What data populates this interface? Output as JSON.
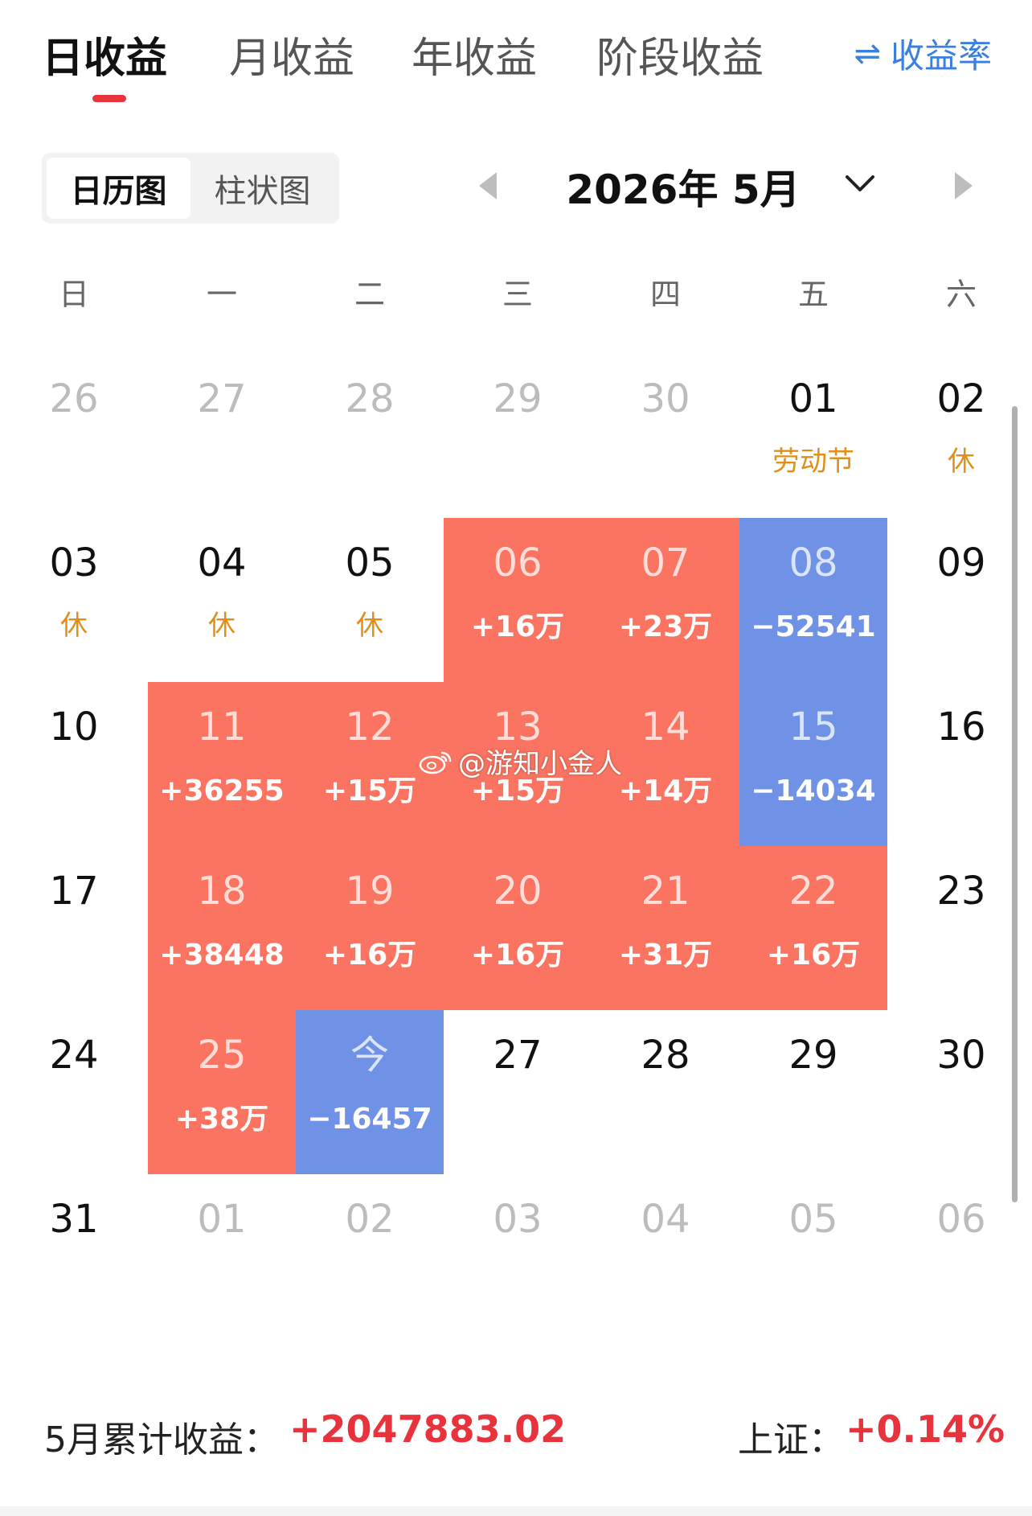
{
  "tabs": [
    {
      "label": "日收益",
      "active": true
    },
    {
      "label": "月收益",
      "active": false
    },
    {
      "label": "年收益",
      "active": false
    },
    {
      "label": "阶段收益",
      "active": false
    }
  ],
  "rate_toggle": {
    "icon": "swap-arrows-icon",
    "label": "收益率"
  },
  "view_switch": [
    {
      "label": "日历图",
      "active": true
    },
    {
      "label": "柱状图",
      "active": false
    }
  ],
  "month_nav": {
    "title": "2026年 5月"
  },
  "weekdays": [
    "日",
    "一",
    "二",
    "三",
    "四",
    "五",
    "六"
  ],
  "calendar": {
    "weeks": [
      [
        {
          "day": "26",
          "other": true
        },
        {
          "day": "27",
          "other": true
        },
        {
          "day": "28",
          "other": true
        },
        {
          "day": "29",
          "other": true
        },
        {
          "day": "30",
          "other": true
        },
        {
          "day": "01",
          "holiday": "劳动节"
        },
        {
          "day": "02",
          "holiday": "休"
        }
      ],
      [
        {
          "day": "03",
          "holiday": "休"
        },
        {
          "day": "04",
          "holiday": "休"
        },
        {
          "day": "05",
          "holiday": "休"
        },
        {
          "day": "06",
          "value": "+16万",
          "tone": "red"
        },
        {
          "day": "07",
          "value": "+23万",
          "tone": "red"
        },
        {
          "day": "08",
          "value": "−52541",
          "tone": "blue"
        },
        {
          "day": "09"
        }
      ],
      [
        {
          "day": "10"
        },
        {
          "day": "11",
          "value": "+36255",
          "tone": "red"
        },
        {
          "day": "12",
          "value": "+15万",
          "tone": "red"
        },
        {
          "day": "13",
          "value": "+15万",
          "tone": "red"
        },
        {
          "day": "14",
          "value": "+14万",
          "tone": "red"
        },
        {
          "day": "15",
          "value": "−14034",
          "tone": "blue"
        },
        {
          "day": "16"
        }
      ],
      [
        {
          "day": "17"
        },
        {
          "day": "18",
          "value": "+38448",
          "tone": "red"
        },
        {
          "day": "19",
          "value": "+16万",
          "tone": "red"
        },
        {
          "day": "20",
          "value": "+16万",
          "tone": "red"
        },
        {
          "day": "21",
          "value": "+31万",
          "tone": "red"
        },
        {
          "day": "22",
          "value": "+16万",
          "tone": "red"
        },
        {
          "day": "23"
        }
      ],
      [
        {
          "day": "24"
        },
        {
          "day": "25",
          "value": "+38万",
          "tone": "red"
        },
        {
          "day": "今",
          "value": "−16457",
          "tone": "blue"
        },
        {
          "day": "27"
        },
        {
          "day": "28"
        },
        {
          "day": "29"
        },
        {
          "day": "30"
        }
      ],
      [
        {
          "day": "31"
        },
        {
          "day": "01",
          "other": true
        },
        {
          "day": "02",
          "other": true
        },
        {
          "day": "03",
          "other": true
        },
        {
          "day": "04",
          "other": true
        },
        {
          "day": "05",
          "other": true
        },
        {
          "day": "06",
          "other": true
        }
      ]
    ]
  },
  "colors": {
    "profit": "#fa7461",
    "loss": "#7092e6",
    "holiday": "#e0901a",
    "accent": "#e8323c",
    "link": "#3b7fe0"
  },
  "watermark": {
    "icon": "weibo-icon",
    "text": "@游知小金人"
  },
  "footer": {
    "label": "5月累计收益：",
    "value": "+2047883.02",
    "index_label": "上证：",
    "index_value": "+0.14%"
  }
}
